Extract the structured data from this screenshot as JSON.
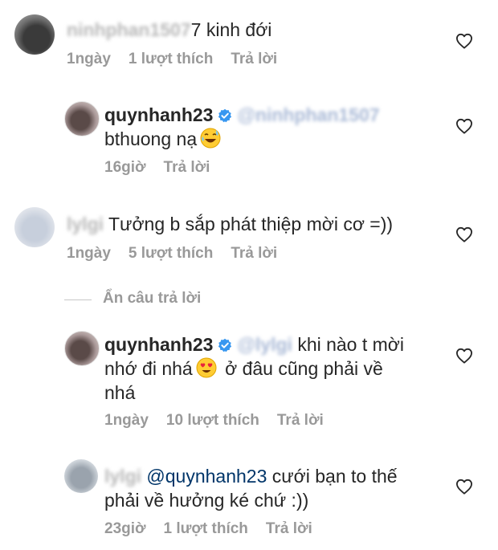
{
  "comments": [
    {
      "username_obscured": "ninhphan1507",
      "text": "7 kinh đới",
      "time": "1ngày",
      "likes": "1 lượt thích",
      "reply": "Trả lời"
    },
    {
      "username": "quynhanh23",
      "mention_obscured": "@ninhphan1507",
      "text": "bthuong nạ",
      "time": "16giờ",
      "reply": "Trả lời"
    },
    {
      "username_obscured": "lylgi",
      "text": "Tưởng b sắp phát thiệp mời cơ =))",
      "time": "1ngày",
      "likes": "5 lượt thích",
      "reply": "Trả lời"
    },
    {
      "username": "quynhanh23",
      "mention_obscured": "@lylgi",
      "text_part1": "khi nào t mời",
      "text_part2": "nhớ đi nhá",
      "text_part3": "ở đâu cũng phải về",
      "text_part4": "nhá",
      "time": "1ngày",
      "likes": "10 lượt thích",
      "reply": "Trả lời"
    },
    {
      "username_obscured": "lylgi",
      "mention": "@quynhanh23",
      "text_part1": "cưới bạn to thế",
      "text_part2": "phải về hưởng ké chứ :))",
      "time": "23giờ",
      "likes": "1 lượt thích",
      "reply": "Trả lời"
    }
  ],
  "hide_replies": "Ẩn câu trả lời",
  "icons": {
    "heart": "heart-outline-icon",
    "verified": "verified-badge-icon",
    "emoji_sweat": "grinning-sweat-emoji",
    "emoji_hearts": "heart-eyes-emoji"
  },
  "colors": {
    "verified_blue": "#3897f0",
    "meta_gray": "#999999",
    "mention_blue": "#003569"
  }
}
